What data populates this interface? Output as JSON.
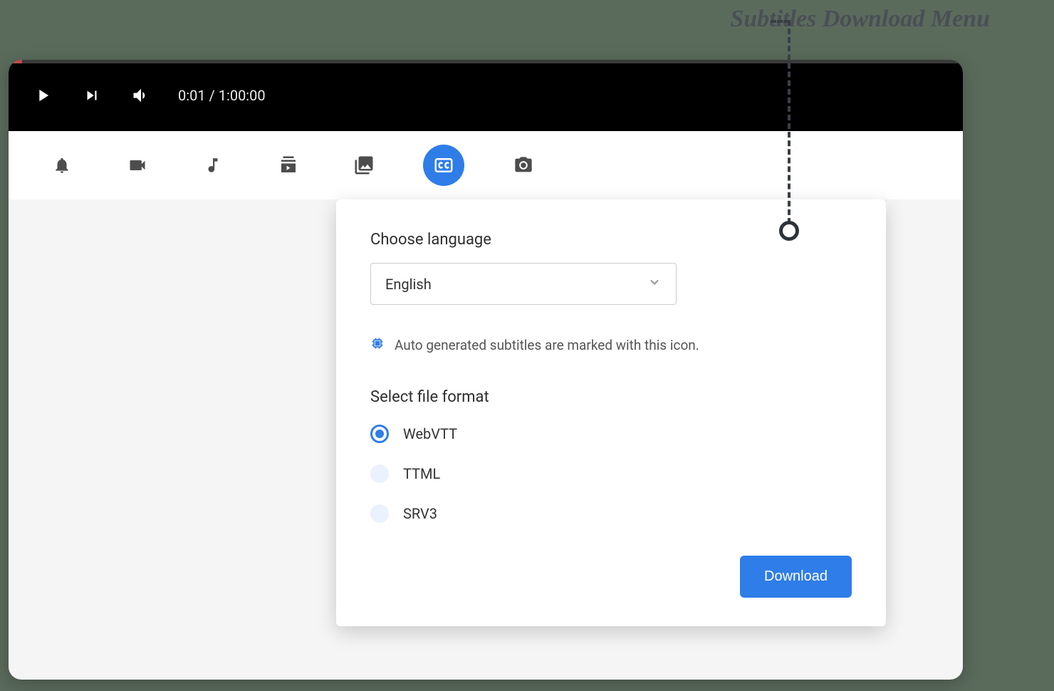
{
  "annotation": "Subtitles Download Menu",
  "player": {
    "time": "0:01 / 1:00:00"
  },
  "tabs": [
    {
      "name": "notifications",
      "icon": "bell"
    },
    {
      "name": "video",
      "icon": "video"
    },
    {
      "name": "audio",
      "icon": "music"
    },
    {
      "name": "playlist",
      "icon": "playlist"
    },
    {
      "name": "images",
      "icon": "images"
    },
    {
      "name": "subtitles",
      "icon": "cc",
      "active": true
    },
    {
      "name": "snapshot",
      "icon": "camera"
    }
  ],
  "popup": {
    "choose_language_label": "Choose language",
    "language_selected": "English",
    "auto_generated_note": "Auto generated subtitles are marked with this icon.",
    "select_format_label": "Select file format",
    "formats": [
      {
        "label": "WebVTT",
        "selected": true
      },
      {
        "label": "TTML",
        "selected": false
      },
      {
        "label": "SRV3",
        "selected": false
      }
    ],
    "download_label": "Download"
  }
}
